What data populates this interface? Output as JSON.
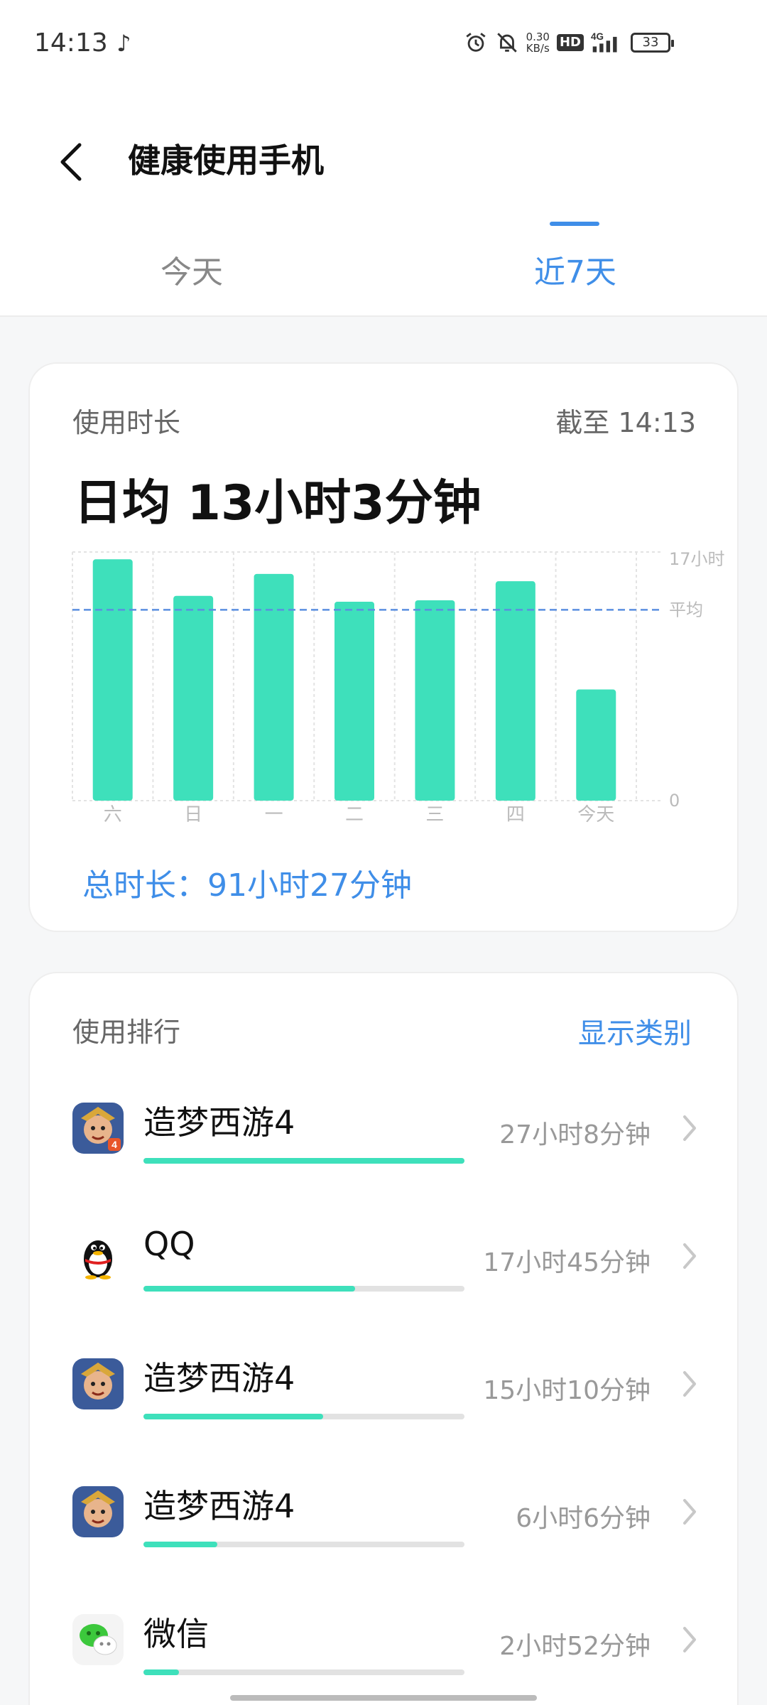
{
  "status_bar": {
    "time": "14:13",
    "music_icon": "music-note-icon",
    "net_speed_value": "0.30",
    "net_speed_unit": "KB/s",
    "hd_label": "HD",
    "network_label": "4G",
    "battery": "33"
  },
  "header": {
    "title": "健康使用手机",
    "tabs": [
      {
        "label": "今天",
        "active": false
      },
      {
        "label": "近7天",
        "active": true
      }
    ]
  },
  "usage": {
    "label": "使用时长",
    "cutoff": "截至 14:13",
    "daily_average": "日均 13小时3分钟",
    "total": "总时长：91小时27分钟"
  },
  "chart_data": {
    "type": "bar",
    "categories": [
      "六",
      "日",
      "一",
      "二",
      "三",
      "四",
      "今天"
    ],
    "values": [
      16.5,
      14.0,
      15.5,
      13.6,
      13.7,
      15.0,
      7.6
    ],
    "ylim": [
      0,
      17
    ],
    "y_axis_labels": {
      "max": "17小时",
      "avg": "平均",
      "zero": "0"
    },
    "average_value": 13.05,
    "bar_color": "#3ee0bb",
    "avg_line_color": "#5b8fe0"
  },
  "ranking": {
    "label": "使用排行",
    "show_category": "显示类别",
    "apps": [
      {
        "name": "造梦西游4",
        "time": "27小时8分钟",
        "fraction": 1.0,
        "icon": "game-hero-icon"
      },
      {
        "name": "QQ",
        "time": "17小时45分钟",
        "fraction": 0.66,
        "icon": "qq-penguin-icon"
      },
      {
        "name": "造梦西游4",
        "time": "15小时10分钟",
        "fraction": 0.56,
        "icon": "game-hero-icon"
      },
      {
        "name": "造梦西游4",
        "time": "6小时6分钟",
        "fraction": 0.23,
        "icon": "game-hero-icon"
      },
      {
        "name": "微信",
        "time": "2小时52分钟",
        "fraction": 0.11,
        "icon": "wechat-icon"
      }
    ]
  },
  "colors": {
    "accent": "#3f8ee8",
    "bar": "#3ee0bb"
  }
}
